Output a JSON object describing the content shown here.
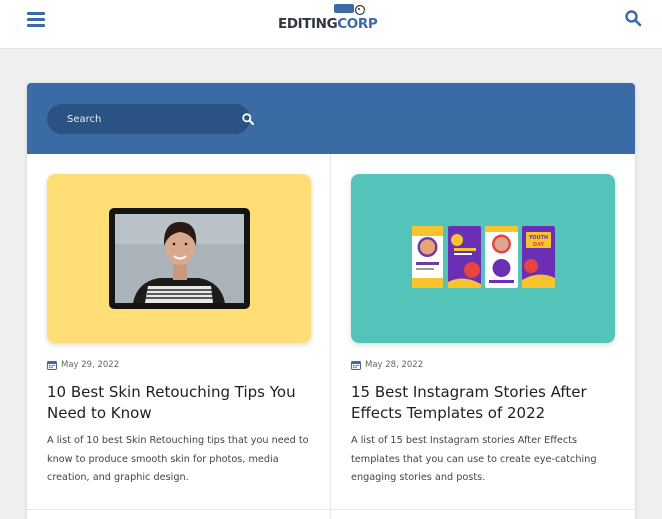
{
  "header": {
    "logo": {
      "part1": "EDITING",
      "part2": "CORP"
    },
    "icons": [
      "hamburger-menu-icon",
      "search-icon"
    ]
  },
  "search": {
    "placeholder": "Search"
  },
  "posts": [
    {
      "date": "May 29, 2022",
      "title": "10 Best Skin Retouching Tips You Need to Know",
      "excerpt": "A list of 10 best Skin Retouching tips that you need to know to produce smooth skin for photos, media creation, and graphic design.",
      "thumbnail_bg": "#ffdf75"
    },
    {
      "date": "May 28, 2022",
      "title": "15 Best Instagram Stories After Effects Templates of 2022",
      "excerpt": "A list of 15 best Instagram stories After Effects templates that you can use to create eye-catching engaging stories and posts.",
      "thumbnail_bg": "#54c4bb",
      "thumbnail_text": "YOUTH DAY"
    }
  ],
  "colors": {
    "brand_blue": "#3b6ba5",
    "search_bg": "#2a5283",
    "page_bg": "#efefef"
  }
}
